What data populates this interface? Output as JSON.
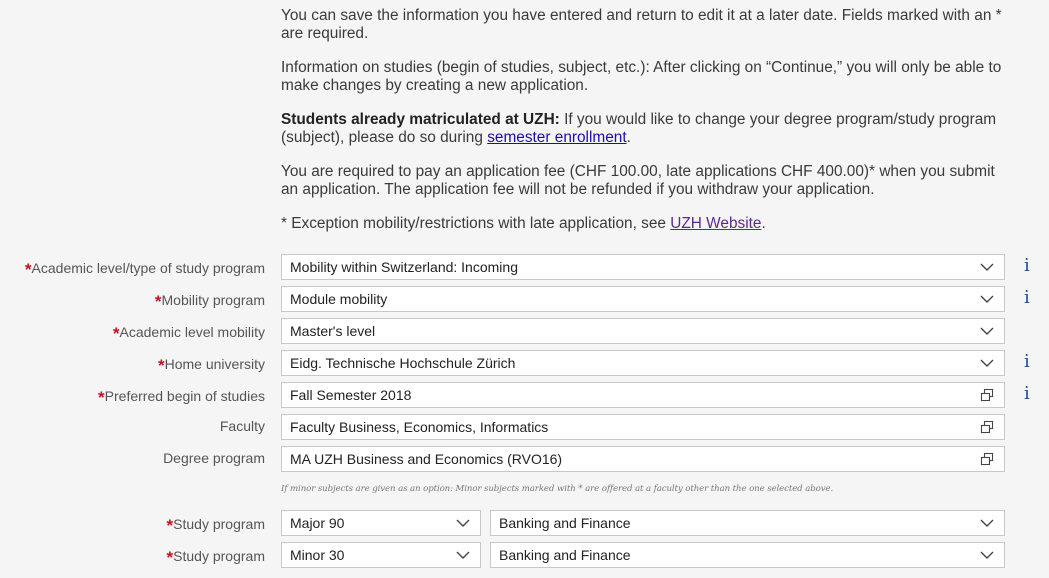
{
  "intro": {
    "p1": "You can save the information you have entered and return to edit it at a later date. Fields marked with an * are required.",
    "p2": "Information on studies (begin of studies, subject, etc.): After clicking on “Continue,” you will only be able to make changes by creating a new application.",
    "p3_bold": "Students already matriculated at UZH:",
    "p3_text": " If you would like to change your degree program/study program (subject), please do so during ",
    "p3_link": "semester enrollment",
    "p3_end": ".",
    "p4": "You are required to pay an application fee (CHF 100.00, late applications CHF 400.00)* when you submit an application. The application fee will not be refunded if you withdraw your application.",
    "p5_text": "* Exception mobility/restrictions with late application, see ",
    "p5_link": "UZH Website",
    "p5_end": "."
  },
  "required_marker": "*",
  "info_icon_glyph": "i",
  "form": {
    "academic_level": {
      "label": "Academic level/type of study program",
      "value": "Mobility within Switzerland: Incoming"
    },
    "mobility_program": {
      "label": "Mobility program",
      "value": "Module mobility"
    },
    "academic_level_mobility": {
      "label": "Academic level mobility",
      "value": "Master's level"
    },
    "home_university": {
      "label": "Home university",
      "value": "Eidg. Technische Hochschule Zürich"
    },
    "begin_of_studies": {
      "label": "Preferred begin of studies",
      "value": "Fall Semester 2018"
    },
    "faculty": {
      "label": "Faculty",
      "value": "Faculty Business, Economics, Informatics"
    },
    "degree_program": {
      "label": "Degree program",
      "value": "MA UZH Business and Economics (RVO16)"
    },
    "minor_note": "If minor subjects are given as an option: Minor subjects marked with * are offered at a faculty other than the one selected above.",
    "study_program_1": {
      "label": "Study program",
      "type_value": "Major 90",
      "subject_value": "Banking and Finance"
    },
    "study_program_2": {
      "label": "Study program",
      "type_value": "Minor 30",
      "subject_value": "Banking and Finance"
    }
  },
  "colors": {
    "required": "#c0141e",
    "info_icon": "#1c4aa0",
    "link": "#1a0dab",
    "visited_link": "#5a2a8a"
  }
}
